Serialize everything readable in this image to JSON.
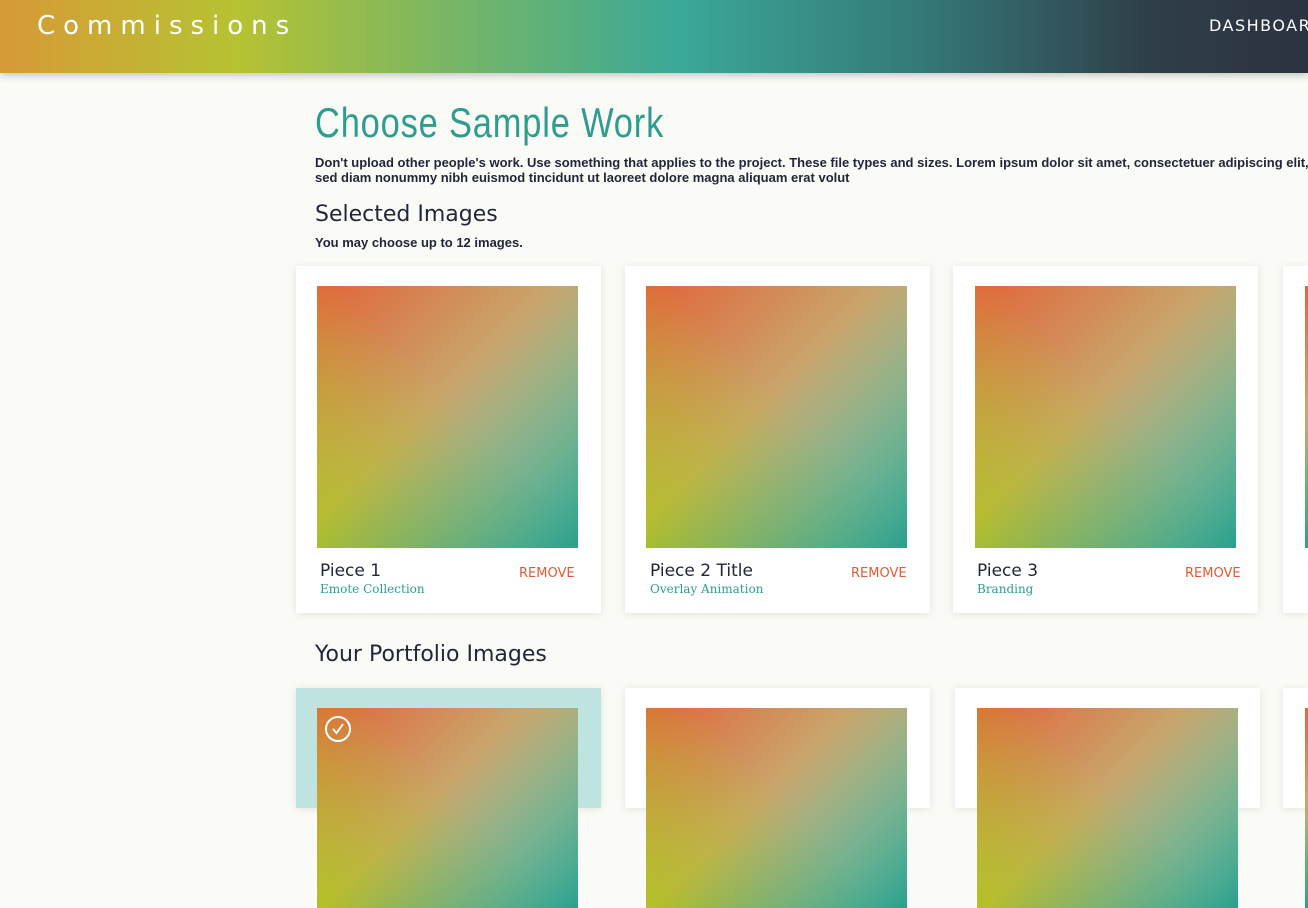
{
  "header": {
    "brand": "Commissions",
    "nav_dashboard": "DASHBOARD"
  },
  "main": {
    "title": "Choose Sample Work",
    "intro": "Don't upload other people's work. Use something that applies to the project. These file types and sizes. Lorem ipsum dolor sit amet, consectetuer adipiscing elit, sed diam nonummy nibh euismod tincidunt ut laoreet dolore magna aliquam erat volut",
    "selected": {
      "title": "Selected Images",
      "helper": "You may choose up to 12 images.",
      "remove_label": "REMOVE",
      "items": [
        {
          "title": "Piece 1",
          "subtitle": "Emote Collection"
        },
        {
          "title": "Piece 2 Title",
          "subtitle": "Overlay Animation"
        },
        {
          "title": "Piece 3",
          "subtitle": "Branding"
        }
      ]
    },
    "portfolio": {
      "title": "Your Portfolio Images"
    }
  },
  "colors": {
    "accent_teal": "#2e9d8e",
    "remove_red": "#e05a33",
    "selected_bg": "#bfe3de"
  }
}
